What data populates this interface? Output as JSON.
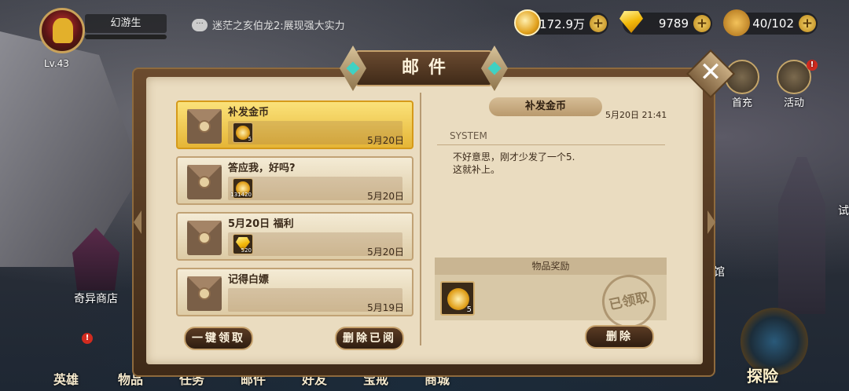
{
  "player": {
    "level": "Lv.43",
    "name": "幻游生"
  },
  "chat": {
    "message": "迷茫之亥伯龙2:展现强大实力"
  },
  "resources": {
    "gold": "172.9万",
    "gems": "9789",
    "stamina": "40/102"
  },
  "side_buttons": {
    "first_charge": "首充",
    "activity": "活动",
    "shop": "奇异商店",
    "hall_fragment": "馆",
    "side_fragment": "试"
  },
  "bottom_nav": [
    "英雄",
    "物品",
    "任务",
    "邮件",
    "好友",
    "宝戒",
    "商城"
  ],
  "explore_label": "探险",
  "window": {
    "title": "邮件"
  },
  "mails": [
    {
      "title": "补发金币",
      "date": "5月20日",
      "item_count": "5",
      "item_type": "coin",
      "selected": true
    },
    {
      "title": "答应我，好吗?",
      "date": "5月20日",
      "item_count": "131420",
      "item_type": "coin",
      "selected": false
    },
    {
      "title": "5月20日 福利",
      "date": "5月20日",
      "item_count": "520",
      "item_type": "gem",
      "selected": false
    },
    {
      "title": "记得白嫖",
      "date": "5月19日",
      "item_count": "",
      "item_type": "none",
      "selected": false
    }
  ],
  "buttons": {
    "claim_all": "一键领取",
    "delete_read": "删除已阅",
    "delete": "删除"
  },
  "detail": {
    "title": "补发金币",
    "date": "5月20日 21:41",
    "sender": "SYSTEM",
    "body": "不好意思，刚才少发了一个5.\n这就补上。",
    "reward_header": "物品奖励",
    "reward_count": "5",
    "stamp": "已领取"
  }
}
